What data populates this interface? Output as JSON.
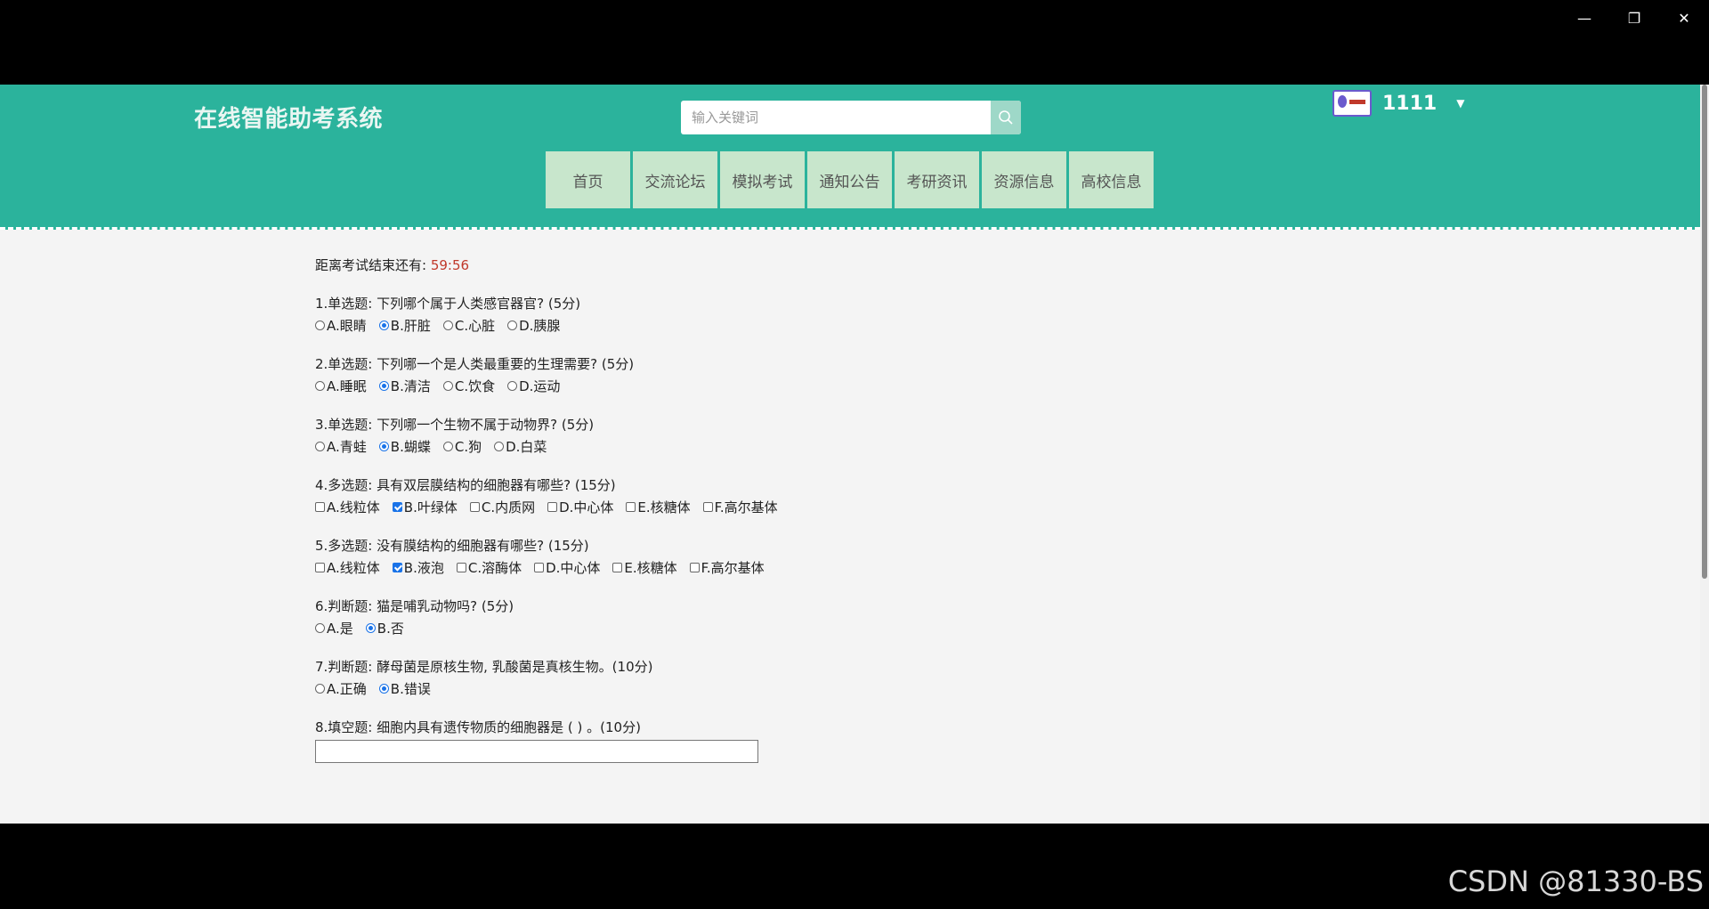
{
  "window_controls": {
    "minimize": "—",
    "restore": "❐",
    "close": "✕"
  },
  "header": {
    "logo": "在线智能助考系统",
    "search_placeholder": "输入关键词",
    "user_name": "1111",
    "nav": [
      "首页",
      "交流论坛",
      "模拟考试",
      "通知公告",
      "考研资讯",
      "资源信息",
      "高校信息"
    ]
  },
  "exam": {
    "timer_label": "距离考试结束还有:",
    "timer_value": "59:56",
    "questions": [
      {
        "title": "1.单选题: 下列哪个属于人类感官器官? (5分)",
        "type": "radio",
        "options": [
          {
            "label": "A.眼睛",
            "checked": false
          },
          {
            "label": "B.肝脏",
            "checked": true
          },
          {
            "label": "C.心脏",
            "checked": false
          },
          {
            "label": "D.胰腺",
            "checked": false
          }
        ]
      },
      {
        "title": "2.单选题: 下列哪一个是人类最重要的生理需要? (5分)",
        "type": "radio",
        "options": [
          {
            "label": "A.睡眠",
            "checked": false
          },
          {
            "label": "B.清洁",
            "checked": true
          },
          {
            "label": "C.饮食",
            "checked": false
          },
          {
            "label": "D.运动",
            "checked": false
          }
        ]
      },
      {
        "title": "3.单选题: 下列哪一个生物不属于动物界? (5分)",
        "type": "radio",
        "options": [
          {
            "label": "A.青蛙",
            "checked": false
          },
          {
            "label": "B.蝴蝶",
            "checked": true
          },
          {
            "label": "C.狗",
            "checked": false
          },
          {
            "label": "D.白菜",
            "checked": false
          }
        ]
      },
      {
        "title": "4.多选题: 具有双层膜结构的细胞器有哪些? (15分)",
        "type": "checkbox",
        "options": [
          {
            "label": "A.线粒体",
            "checked": false
          },
          {
            "label": "B.叶绿体",
            "checked": true
          },
          {
            "label": "C.内质网",
            "checked": false
          },
          {
            "label": "D.中心体",
            "checked": false
          },
          {
            "label": "E.核糖体",
            "checked": false
          },
          {
            "label": "F.高尔基体",
            "checked": false
          }
        ]
      },
      {
        "title": "5.多选题: 没有膜结构的细胞器有哪些? (15分)",
        "type": "checkbox",
        "options": [
          {
            "label": "A.线粒体",
            "checked": false
          },
          {
            "label": "B.液泡",
            "checked": true
          },
          {
            "label": "C.溶酶体",
            "checked": false
          },
          {
            "label": "D.中心体",
            "checked": false
          },
          {
            "label": "E.核糖体",
            "checked": false
          },
          {
            "label": "F.高尔基体",
            "checked": false
          }
        ]
      },
      {
        "title": "6.判断题: 猫是哺乳动物吗? (5分)",
        "type": "radio",
        "options": [
          {
            "label": "A.是",
            "checked": false
          },
          {
            "label": "B.否",
            "checked": true
          }
        ]
      },
      {
        "title": "7.判断题: 酵母菌是原核生物, 乳酸菌是真核生物。(10分)",
        "type": "radio",
        "options": [
          {
            "label": "A.正确",
            "checked": false
          },
          {
            "label": "B.错误",
            "checked": true
          }
        ]
      },
      {
        "title": "8.填空题: 细胞内具有遗传物质的细胞器是 ( ) 。(10分)",
        "type": "fill",
        "value": ""
      }
    ]
  },
  "watermark": "CSDN @81330-BS"
}
